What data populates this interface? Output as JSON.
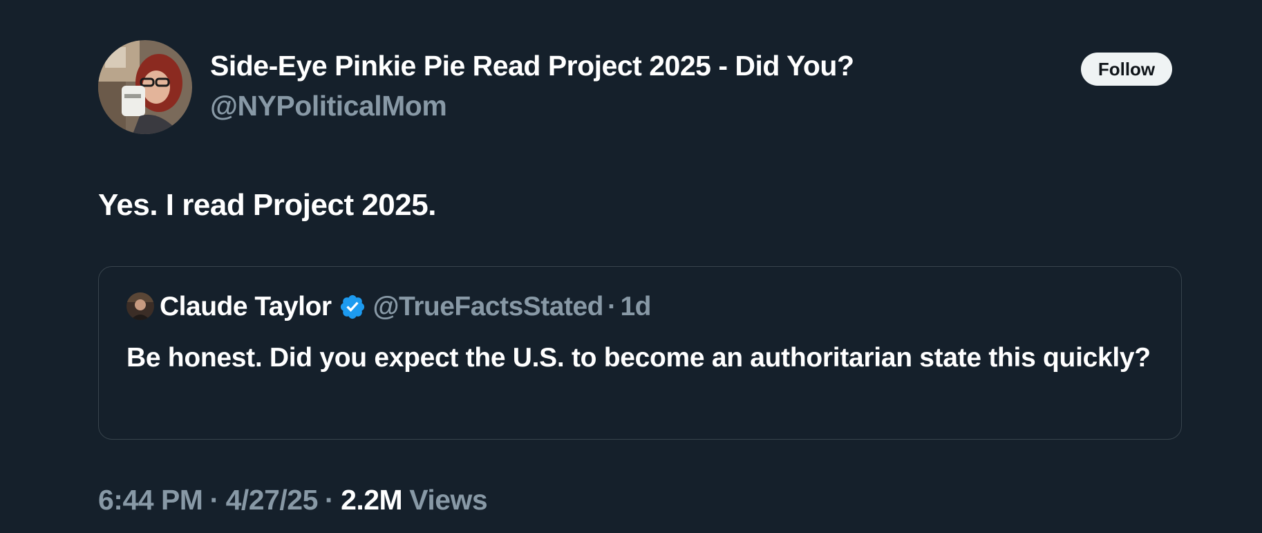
{
  "tweet": {
    "author": {
      "name": "Side-Eye Pinkie Pie Read Project 2025 - Did You?",
      "handle": "@NYPoliticalMom"
    },
    "follow_label": "Follow",
    "text": "Yes. I read Project 2025.",
    "quoted": {
      "author_name": "Claude Taylor",
      "author_handle": "@TrueFactsStated",
      "separator": "·",
      "time": "1d",
      "text": "Be honest. Did you expect the U.S. to become an authoritarian state this quickly?",
      "verified_icon": "verified-badge-icon"
    },
    "meta": {
      "time": "6:44 PM",
      "separator": "·",
      "date": "4/27/25",
      "views_count": "2.2M",
      "views_label": "Views"
    }
  },
  "colors": {
    "background": "#15202b",
    "primary_text": "#ffffff",
    "secondary_text": "#8899a6",
    "border": "#38444d",
    "verified": "#1d9bf0",
    "follow_bg": "#eff3f4"
  }
}
